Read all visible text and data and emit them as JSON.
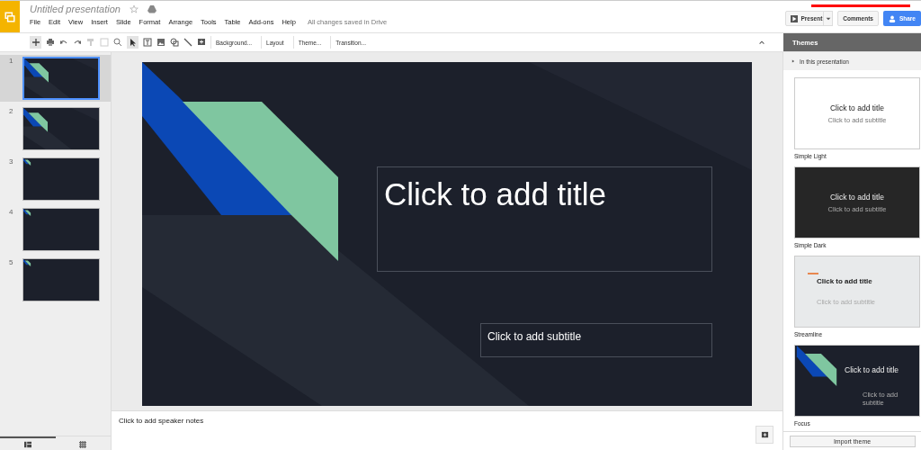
{
  "app": {
    "title": "Untitled presentation",
    "menu": [
      "File",
      "Edit",
      "View",
      "Insert",
      "Slide",
      "Format",
      "Arrange",
      "Tools",
      "Table",
      "Add-ons",
      "Help"
    ],
    "save_status": "All changes saved in Drive"
  },
  "header_buttons": {
    "present": "Present",
    "comments": "Comments",
    "share": "Share"
  },
  "toolbar": {
    "buttons": [
      "Background...",
      "Layout",
      "Theme...",
      "Transition..."
    ]
  },
  "slides": [
    {
      "number": "1",
      "selected": true,
      "kind": "large"
    },
    {
      "number": "2",
      "selected": false,
      "kind": "large"
    },
    {
      "number": "3",
      "selected": false,
      "kind": "small"
    },
    {
      "number": "4",
      "selected": false,
      "kind": "small"
    },
    {
      "number": "5",
      "selected": false,
      "kind": "small"
    }
  ],
  "view_tabs": [
    {
      "kind": "filmstrip",
      "selected": true
    },
    {
      "kind": "grid",
      "selected": false
    }
  ],
  "slide": {
    "title_placeholder": "Click to add title",
    "subtitle_placeholder": "Click to add subtitle"
  },
  "notes": {
    "placeholder": "Click to add speaker notes"
  },
  "themes_panel": {
    "title": "Themes",
    "section": "In this presentation",
    "import_button": "Import theme",
    "themes": [
      {
        "name": "Simple Light",
        "kind": "light",
        "title": "Click to add title",
        "subtitle": "Click to add subtitle"
      },
      {
        "name": "Simple Dark",
        "kind": "dark",
        "title": "Click to add title",
        "subtitle": "Click to add subtitle"
      },
      {
        "name": "Streamline",
        "kind": "streamline",
        "title": "Click to add title",
        "subtitle": "Click to add subtitle"
      },
      {
        "name": "Focus",
        "kind": "focus",
        "title": "Click to add title",
        "subtitle": "Click to add subtitle"
      }
    ]
  }
}
